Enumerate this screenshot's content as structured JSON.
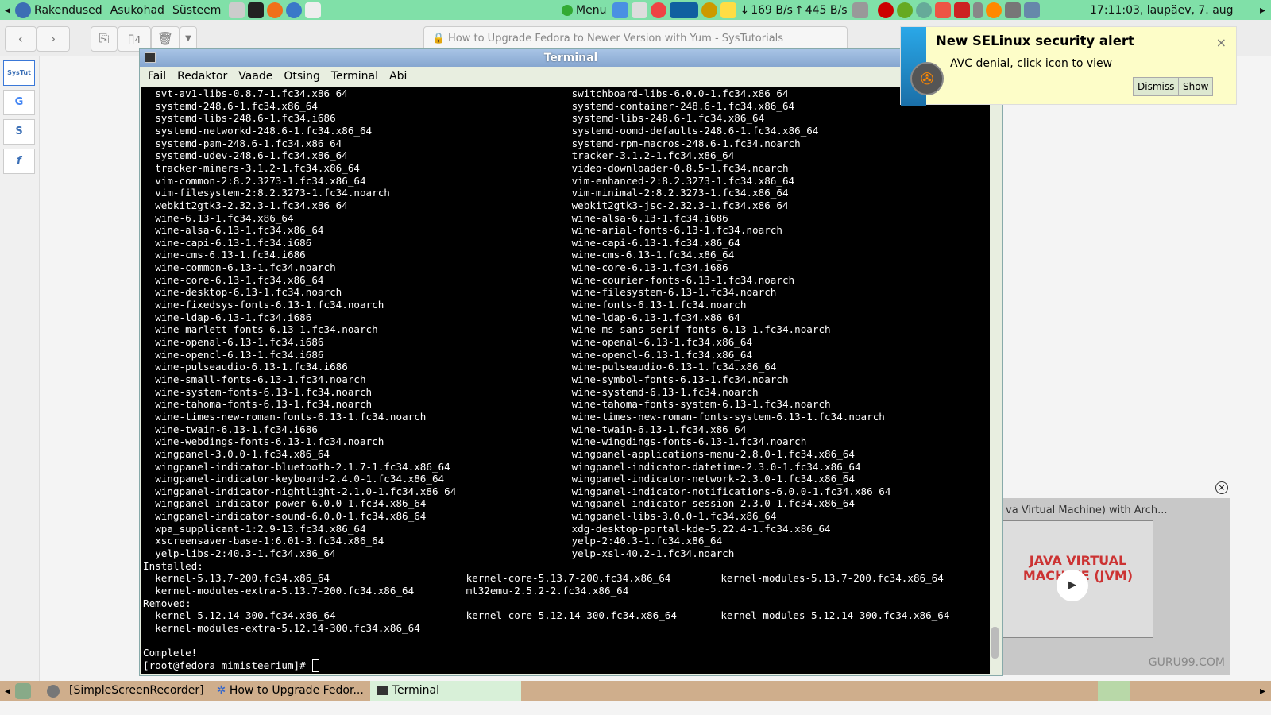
{
  "panel": {
    "menus": [
      "Rakendused",
      "Asukohad",
      "Süsteem"
    ],
    "menu_label": "Menu",
    "net_down": "169 B/s",
    "net_up": "445 B/s",
    "clock": "17:11:03, laupäev,  7. aug"
  },
  "browser": {
    "tab_count": "4",
    "url_title": "How to Upgrade Fedora to Newer Version with Yum - SysTutorials",
    "sidebar": [
      "SysTut",
      "G",
      "S",
      "f"
    ]
  },
  "terminal": {
    "title": "Terminal",
    "menu": [
      "Fail",
      "Redaktor",
      "Vaade",
      "Otsing",
      "Terminal",
      "Abi"
    ],
    "rows": [
      [
        "svt-av1-libs-0.8.7-1.fc34.x86_64",
        "switchboard-libs-6.0.0-1.fc34.x86_64"
      ],
      [
        "systemd-248.6-1.fc34.x86_64",
        "systemd-container-248.6-1.fc34.x86_64"
      ],
      [
        "systemd-libs-248.6-1.fc34.i686",
        "systemd-libs-248.6-1.fc34.x86_64"
      ],
      [
        "systemd-networkd-248.6-1.fc34.x86_64",
        "systemd-oomd-defaults-248.6-1.fc34.x86_64"
      ],
      [
        "systemd-pam-248.6-1.fc34.x86_64",
        "systemd-rpm-macros-248.6-1.fc34.noarch"
      ],
      [
        "systemd-udev-248.6-1.fc34.x86_64",
        "tracker-3.1.2-1.fc34.x86_64"
      ],
      [
        "tracker-miners-3.1.2-1.fc34.x86_64",
        "video-downloader-0.8.5-1.fc34.noarch"
      ],
      [
        "vim-common-2:8.2.3273-1.fc34.x86_64",
        "vim-enhanced-2:8.2.3273-1.fc34.x86_64"
      ],
      [
        "vim-filesystem-2:8.2.3273-1.fc34.noarch",
        "vim-minimal-2:8.2.3273-1.fc34.x86_64"
      ],
      [
        "webkit2gtk3-2.32.3-1.fc34.x86_64",
        "webkit2gtk3-jsc-2.32.3-1.fc34.x86_64"
      ],
      [
        "wine-6.13-1.fc34.x86_64",
        "wine-alsa-6.13-1.fc34.i686"
      ],
      [
        "wine-alsa-6.13-1.fc34.x86_64",
        "wine-arial-fonts-6.13-1.fc34.noarch"
      ],
      [
        "wine-capi-6.13-1.fc34.i686",
        "wine-capi-6.13-1.fc34.x86_64"
      ],
      [
        "wine-cms-6.13-1.fc34.i686",
        "wine-cms-6.13-1.fc34.x86_64"
      ],
      [
        "wine-common-6.13-1.fc34.noarch",
        "wine-core-6.13-1.fc34.i686"
      ],
      [
        "wine-core-6.13-1.fc34.x86_64",
        "wine-courier-fonts-6.13-1.fc34.noarch"
      ],
      [
        "wine-desktop-6.13-1.fc34.noarch",
        "wine-filesystem-6.13-1.fc34.noarch"
      ],
      [
        "wine-fixedsys-fonts-6.13-1.fc34.noarch",
        "wine-fonts-6.13-1.fc34.noarch"
      ],
      [
        "wine-ldap-6.13-1.fc34.i686",
        "wine-ldap-6.13-1.fc34.x86_64"
      ],
      [
        "wine-marlett-fonts-6.13-1.fc34.noarch",
        "wine-ms-sans-serif-fonts-6.13-1.fc34.noarch"
      ],
      [
        "wine-openal-6.13-1.fc34.i686",
        "wine-openal-6.13-1.fc34.x86_64"
      ],
      [
        "wine-opencl-6.13-1.fc34.i686",
        "wine-opencl-6.13-1.fc34.x86_64"
      ],
      [
        "wine-pulseaudio-6.13-1.fc34.i686",
        "wine-pulseaudio-6.13-1.fc34.x86_64"
      ],
      [
        "wine-small-fonts-6.13-1.fc34.noarch",
        "wine-symbol-fonts-6.13-1.fc34.noarch"
      ],
      [
        "wine-system-fonts-6.13-1.fc34.noarch",
        "wine-systemd-6.13-1.fc34.noarch"
      ],
      [
        "wine-tahoma-fonts-6.13-1.fc34.noarch",
        "wine-tahoma-fonts-system-6.13-1.fc34.noarch"
      ],
      [
        "wine-times-new-roman-fonts-6.13-1.fc34.noarch",
        "wine-times-new-roman-fonts-system-6.13-1.fc34.noarch"
      ],
      [
        "wine-twain-6.13-1.fc34.i686",
        "wine-twain-6.13-1.fc34.x86_64"
      ],
      [
        "wine-webdings-fonts-6.13-1.fc34.noarch",
        "wine-wingdings-fonts-6.13-1.fc34.noarch"
      ],
      [
        "wingpanel-3.0.0-1.fc34.x86_64",
        "wingpanel-applications-menu-2.8.0-1.fc34.x86_64"
      ],
      [
        "wingpanel-indicator-bluetooth-2.1.7-1.fc34.x86_64",
        "wingpanel-indicator-datetime-2.3.0-1.fc34.x86_64"
      ],
      [
        "wingpanel-indicator-keyboard-2.4.0-1.fc34.x86_64",
        "wingpanel-indicator-network-2.3.0-1.fc34.x86_64"
      ],
      [
        "wingpanel-indicator-nightlight-2.1.0-1.fc34.x86_64",
        "wingpanel-indicator-notifications-6.0.0-1.fc34.x86_64"
      ],
      [
        "wingpanel-indicator-power-6.0.0-1.fc34.x86_64",
        "wingpanel-indicator-session-2.3.0-1.fc34.x86_64"
      ],
      [
        "wingpanel-indicator-sound-6.0.0-1.fc34.x86_64",
        "wingpanel-libs-3.0.0-1.fc34.x86_64"
      ],
      [
        "wpa_supplicant-1:2.9-13.fc34.x86_64",
        "xdg-desktop-portal-kde-5.22.4-1.fc34.x86_64"
      ],
      [
        "xscreensaver-base-1:6.01-3.fc34.x86_64",
        "yelp-2:40.3-1.fc34.x86_64"
      ],
      [
        "yelp-libs-2:40.3-1.fc34.x86_64",
        "yelp-xsl-40.2-1.fc34.noarch"
      ]
    ],
    "installed_label": "Installed:",
    "installed": [
      [
        "kernel-5.13.7-200.fc34.x86_64",
        "kernel-core-5.13.7-200.fc34.x86_64",
        "kernel-modules-5.13.7-200.fc34.x86_64"
      ],
      [
        "kernel-modules-extra-5.13.7-200.fc34.x86_64",
        "mt32emu-2.5.2-2.fc34.x86_64",
        ""
      ]
    ],
    "removed_label": "Removed:",
    "removed": [
      [
        "kernel-5.12.14-300.fc34.x86_64",
        "kernel-core-5.12.14-300.fc34.x86_64",
        "kernel-modules-5.12.14-300.fc34.x86_64"
      ],
      [
        "kernel-modules-extra-5.12.14-300.fc34.x86_64",
        "",
        ""
      ]
    ],
    "complete": "Complete!",
    "prompt": "[root@fedora mimisteerium]# "
  },
  "notification": {
    "title": "New SELinux security alert",
    "body": "AVC denial, click icon to view",
    "dismiss": "Dismiss",
    "show": "Show"
  },
  "video": {
    "title": "va Virtual Machine) with Arch...",
    "thumb_text": "JAVA VIRTUAL MACHINE (JVM)",
    "watermark": "GURU99.COM"
  },
  "taskbar": {
    "tasks": [
      "[SimpleScreenRecorder]",
      "How to Upgrade Fedor...",
      "Terminal"
    ]
  }
}
